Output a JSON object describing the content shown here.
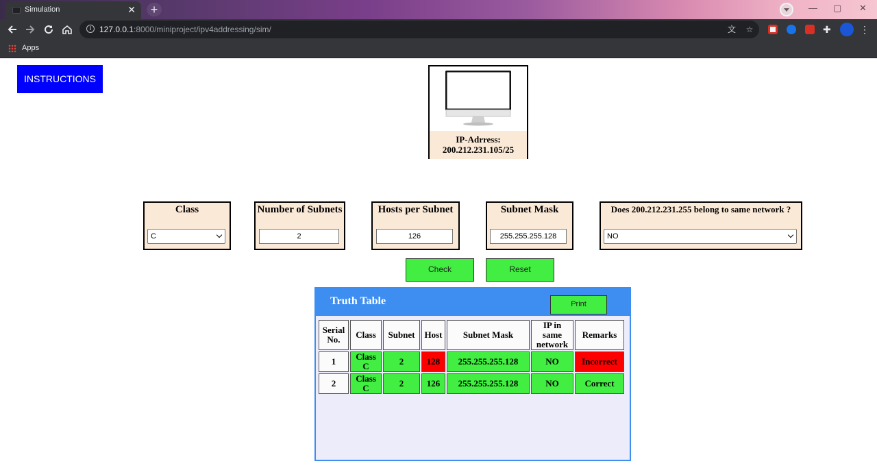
{
  "browser": {
    "tab_title": "Simulation",
    "tab_close": "✕",
    "new_tab": "+",
    "url_host": "127.0.0.1",
    "url_rest": ":8000/miniproject/ipv4addressing/sim/",
    "bookmarks_apps": "Apps"
  },
  "page": {
    "instructions_label": "INSTRUCTIONS",
    "ip_label": "IP-Adrress:",
    "ip_value": "200.212.231.105/25"
  },
  "fields": {
    "class": {
      "title": "Class",
      "value": "C"
    },
    "subnets": {
      "title": "Number of Subnets",
      "value": "2"
    },
    "hosts": {
      "title": "Hosts per Subnet",
      "value": "126"
    },
    "mask": {
      "title": "Subnet Mask",
      "value": "255.255.255.128"
    },
    "network": {
      "title": "Does 200.212.231.255 belong to same network ?",
      "value": "NO"
    }
  },
  "buttons": {
    "check": "Check",
    "reset": "Reset"
  },
  "truth_table": {
    "title": "Truth Table",
    "print": "Print",
    "headers": {
      "serial": "Serial No.",
      "class": "Class",
      "subnet": "Subnet",
      "host": "Host",
      "mask": "Subnet Mask",
      "same": "IP in same network",
      "remarks": "Remarks"
    },
    "rows": [
      {
        "serial": "1",
        "class": "Class C",
        "subnet": "2",
        "host": "128",
        "mask": "255.255.255.128",
        "same": "NO",
        "remarks": "Incorrect"
      },
      {
        "serial": "2",
        "class": "Class C",
        "subnet": "2",
        "host": "126",
        "mask": "255.255.255.128",
        "same": "NO",
        "remarks": "Correct"
      }
    ]
  },
  "colors": {
    "ok": "#41ee41",
    "bad": "#ff0000",
    "accent": "#3d8ef0",
    "instructions": "#0000ff"
  }
}
